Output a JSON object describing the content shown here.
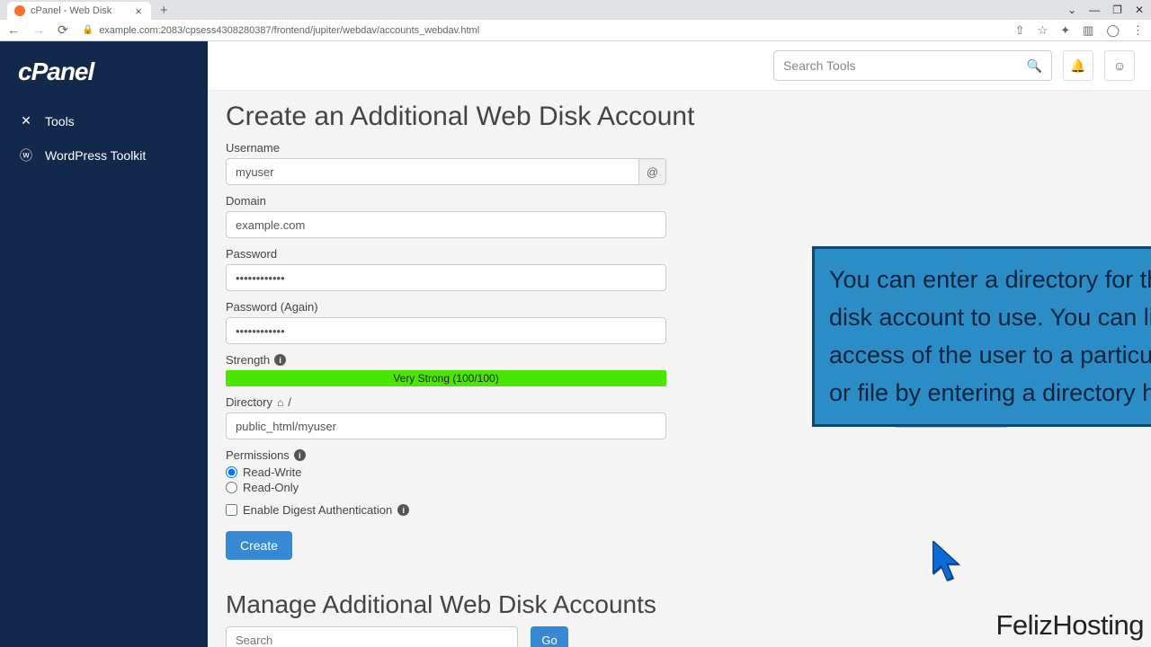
{
  "browser": {
    "tab_title": "cPanel - Web Disk",
    "url": "example.com:2083/cpsess4308280387/frontend/jupiter/webdav/accounts_webdav.html"
  },
  "sidebar": {
    "logo": "cPanel",
    "items": [
      {
        "label": "Tools",
        "icon": "✕"
      },
      {
        "label": "WordPress Toolkit",
        "icon": "ⓦ"
      }
    ]
  },
  "topbar": {
    "search_placeholder": "Search Tools"
  },
  "form": {
    "title": "Create an Additional Web Disk Account",
    "username_label": "Username",
    "username_value": "myuser",
    "at_symbol": "@",
    "domain_label": "Domain",
    "domain_value": "example.com",
    "password_label": "Password",
    "password_value": "••••••••••••",
    "password2_label": "Password (Again)",
    "password2_value": "••••••••••••",
    "strength_label": "Strength",
    "strength_text": "Very Strong (100/100)",
    "directory_label": "Directory",
    "directory_sep": "/",
    "directory_value": "public_html/myuser",
    "permissions_label": "Permissions",
    "perm_rw": "Read-Write",
    "perm_ro": "Read-Only",
    "digest_label": "Enable Digest Authentication",
    "create_btn": "Create"
  },
  "manage": {
    "title": "Manage Additional Web Disk Accounts",
    "search_placeholder": "Search",
    "go_btn": "Go"
  },
  "overlay": {
    "text": "You can enter a directory for the Web disk account to use. You can limit the access of the user to a particular folder or file by entering a directory here."
  },
  "watermark": "FelizHosting"
}
